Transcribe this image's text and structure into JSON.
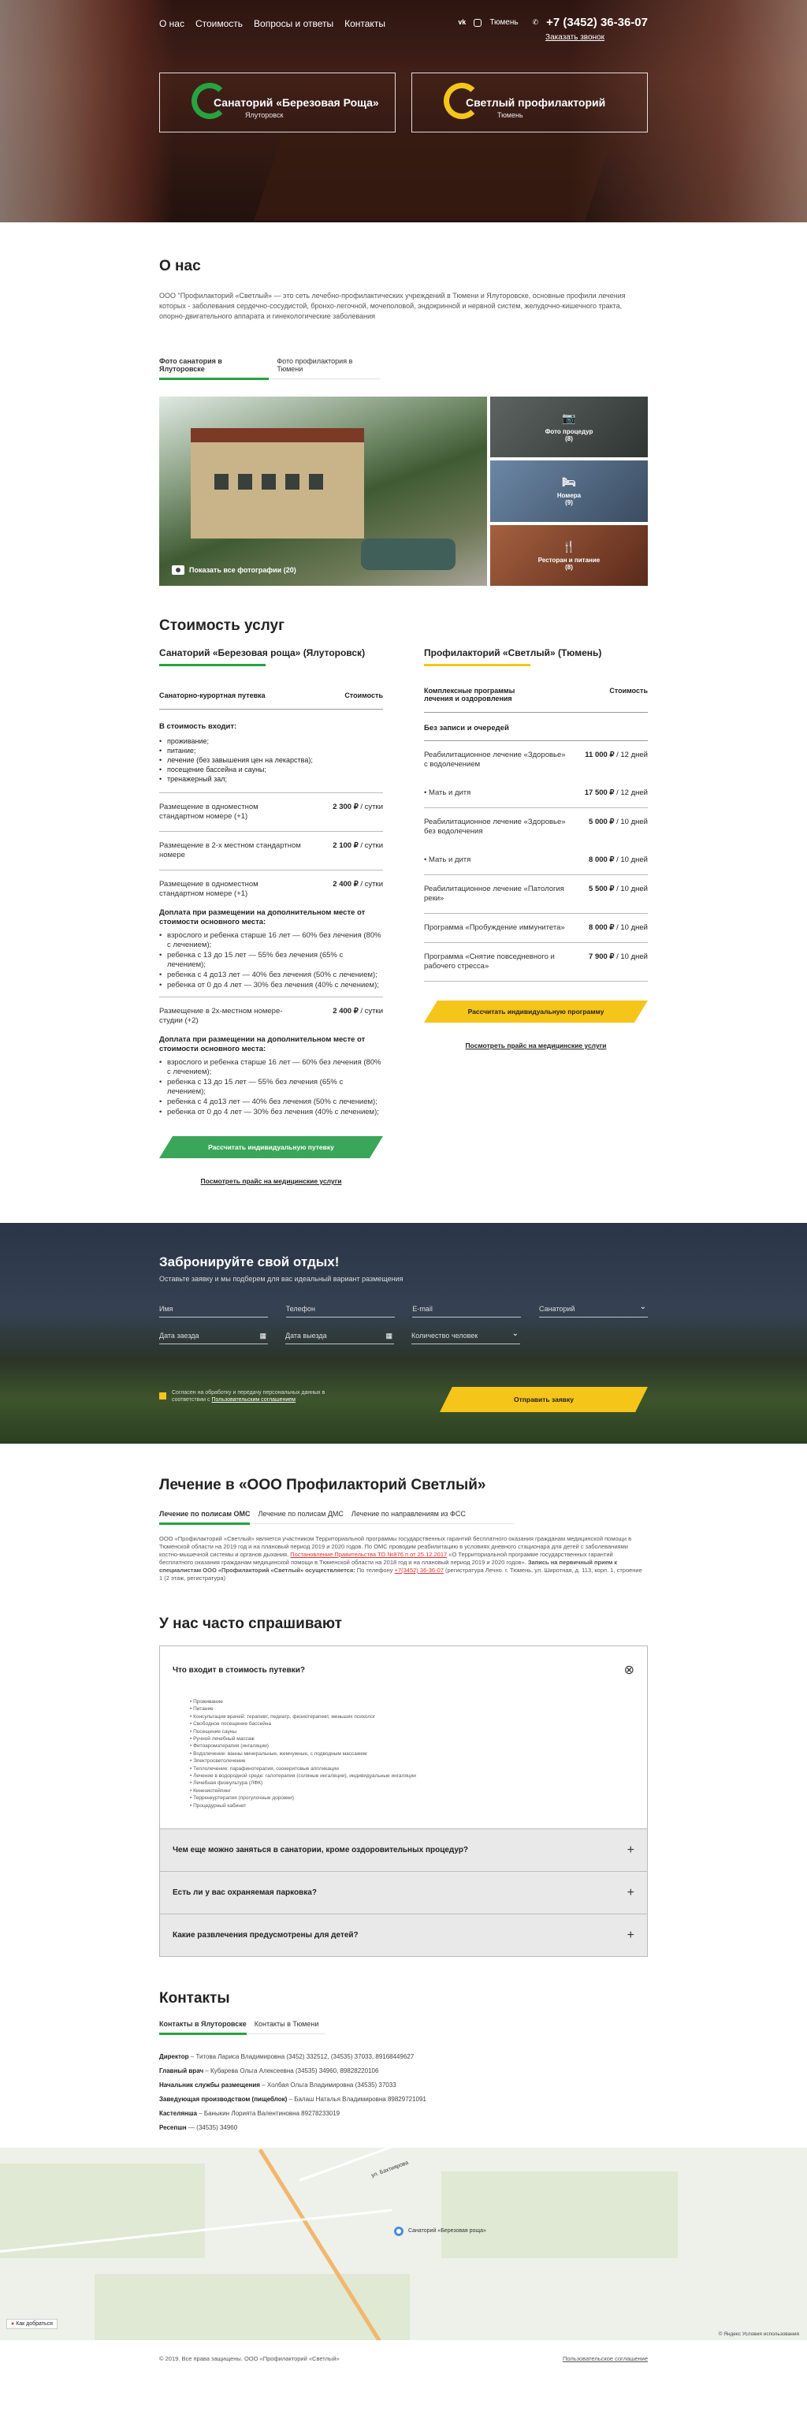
{
  "nav": {
    "items": [
      "О нас",
      "Стоимость",
      "Вопросы и ответы",
      "Контакты"
    ],
    "city": "Тюмень",
    "phone": "+7 (3452) 36-36-07",
    "callback": "Заказать звонок"
  },
  "hero": {
    "card1": {
      "title": "Санаторий «Березовая Роща»",
      "subtitle": "Ялуторовск"
    },
    "card2": {
      "title": "Светлый профилакторий",
      "subtitle": "Тюмень"
    }
  },
  "about": {
    "title": "О нас",
    "text": "ООО \"Профилакторий «Светлый» — это сеть лечебно-профилактических учреждений в Тюмени и Ялуторовске, основные профили лечения которых - заболевания сердечно-сосудистой, бронхо-легочной, мочеполовой, эндокринной и нервной систем, желудочно-кишечного тракта, опорно-двигательного аппарата и гинекологические заболевания",
    "tabs": [
      "Фото санатория в Ялуторовске",
      "Фото профилактория в Тюмени"
    ],
    "gallery": {
      "main_label": "Показать все фотографии (20)",
      "side": [
        {
          "title": "Фото процедур",
          "count": "(8)"
        },
        {
          "title": "Номера",
          "count": "(9)"
        },
        {
          "title": "Ресторан и питание",
          "count": "(8)"
        }
      ]
    }
  },
  "prices": {
    "title": "Стоимость услуг",
    "left": {
      "title": "Санаторий «Березовая роща» (Ялуторовск)",
      "head_name": "Санаторно-курортная путевка",
      "head_cost": "Стоимость",
      "includes_title": "В стоимость входит:",
      "includes": [
        "проживание;",
        "питание;",
        "лечение (без завышения цен на лекарства);",
        "посещение бассейна и сауны;",
        "тренажерный зал;"
      ],
      "rows": [
        {
          "name": "Размещение в одноместном стандартном номере (+1)",
          "price": "2 300 ₽",
          "unit": " / сутки"
        },
        {
          "name": "Размещение в 2-х местном стандартном номере",
          "price": "2 100 ₽",
          "unit": " / сутки"
        },
        {
          "name": "Размещение в одноместном стандартном номере (+1)",
          "price": "2 400 ₽",
          "unit": " / сутки"
        }
      ],
      "extra1_title": "Доплата при размещении на дополнительном месте от стоимости основного места:",
      "extra1": [
        "взрослого и ребенка старше 16 лет — 60% без лечения (80% с лечением);",
        "ребенка с 13 до 15 лет — 55% без лечения (65% с лечением);",
        "ребенка с 4 до13 лет — 40% без лечения (50% с лечением);",
        "ребенка от 0 до 4 лет — 30% без лечения (40% с лечением);"
      ],
      "row4": {
        "name": "Размещение в 2х-местном номере-студии (+2)",
        "price": "2 400 ₽",
        "unit": " / сутки"
      },
      "extra2_title": "Доплата при размещении на дополнительном месте от стоимости основного места:",
      "extra2": [
        "взрослого и ребенка старше 16 лет — 60% без лечения (80% с лечением);",
        "ребенка с 13 до 15 лет — 55% без лечения (65% с лечением);",
        "ребенка с 4 до13 лет — 40% без лечения (50% с лечением);",
        "ребенка от 0 до 4 лет — 30% без лечения (40% с лечением);"
      ],
      "button": "Рассчитать индивидуальную путевку",
      "link": "Посмотреть прайс на медицинские услуги"
    },
    "right": {
      "title": "Профилакторий «Светлый» (Тюмень)",
      "head_name": "Комплексные программы лечения и оздоровления",
      "head_cost": "Стоимость",
      "norec": "Без записи и очередей",
      "rows": [
        {
          "name": "Реабилитационное лечение «Здоровье» с водолечением",
          "price": "11 000 ₽",
          "unit": " / 12 дней"
        },
        {
          "name": "• Мать и дитя",
          "price": "17 500 ₽",
          "unit": " / 12 дней"
        },
        {
          "name": "Реабилитационное лечение «Здоровье» без водолечения",
          "price": "5 000 ₽",
          "unit": " / 10 дней"
        },
        {
          "name": "• Мать и дитя",
          "price": "8 000 ₽",
          "unit": " / 10 дней"
        },
        {
          "name": "Реабилитационное лечение «Патология реки»",
          "price": "5 500 ₽",
          "unit": " / 10 дней"
        },
        {
          "name": "Программа «Пробуждение иммунитета»",
          "price": "8 000 ₽",
          "unit": " / 10 дней"
        },
        {
          "name": "Программа «Снятие повседневного и рабочего стресса»",
          "price": "7 900 ₽",
          "unit": " / 10 дней"
        }
      ],
      "button": "Рассчитать индивидуальную программу",
      "link": "Посмотреть прайс на медицинские услуги"
    }
  },
  "booking": {
    "title": "Забронируйте свой отдых!",
    "subtitle": "Оставьте заявку и мы подберем для вас идеальный вариант размещения",
    "fields": [
      "Имя",
      "Телефон",
      "E-mail",
      "Санаторий"
    ],
    "fields2": [
      "Дата заезда",
      "Дата выезда",
      "Количество человек"
    ],
    "agree_text": "Согласен на обработку и передачу персональных данных в соответствии с ",
    "agree_link": "Пользовательским соглашением",
    "submit": "Отправить заявку"
  },
  "treatment": {
    "title": "Лечение в «ООО Профилакторий Светлый»",
    "tabs": [
      "Лечение по полисам ОМС",
      "Лечение по полисам ДМС",
      "Лечение по направлениям из ФСС"
    ],
    "text1": "ООО «Профилакторий «Светлый» является участником Территориальной программы государственных гарантий бесплатного оказания гражданам медицинской помощи в Тюменской области на 2019 год и на плановый период 2019 и 2020 годов. По ОМС проводим реабилитацию в условиях дневного стационара для детей с заболеваниями костно-мышечной системы и органов дыхания. ",
    "text_red": "Постановление Правительства ТО №876 п от 25.12.2017",
    "text2": " «О Территориальной программе государственных гарантий бесплатного оказания гражданам медицинской помощи в Тюменской области на 2018 год и на плановый период 2019 и 2020 годов». ",
    "text_bold": "Запись на первичный прием к специалистам ООО «Профилакторий «Светлый» осуществляется:",
    "text3": " По телефону ",
    "text_phone": "+7(3452) 36-36-07",
    "text4": " (регистратура Лечно. г. Тюмень, ул. Широтная, д. 113, корп. 1, строение 1 (2 этаж, регистратура)"
  },
  "faq": {
    "title": "У нас часто спрашивают",
    "open_q": "Что входит в стоимость путевки?",
    "open_a": [
      "Проживание",
      "Питание",
      "Консультация врачей: терапевт, педиатр, физиотерапевт, меньших психолог",
      "Свободное посещение бассейна",
      "Посещение сауны",
      "Ручной лечебный массаж",
      "Фитоароматерапия (ингаляции)",
      "Водолечение: ванны минеральные, жемчужные, с подводным массажем",
      "Электросветолечение",
      "Теплолечение: парафинотерапия, озокеритовые аппликации",
      "Лечение в водородной среде: галотерапия (соляные ингаляции), индивидуальные ингаляции",
      "Лечебная физкультура (ЛФК)",
      "Кинезиотейпинг",
      "Терренкуртерапия (прогулочные дорожки)",
      "Процедурный кабинет"
    ],
    "closed": [
      "Чем еще можно заняться в санатории, кроме оздоровительных процедур?",
      "Есть ли у вас охраняемая парковка?",
      "Какие развлечения предусмотрены для детей?"
    ]
  },
  "contacts": {
    "title": "Контакты",
    "tabs": [
      "Контакты в Ялуторовске",
      "Контакты в Тюмени"
    ],
    "list": [
      {
        "role": "Директор",
        "text": " – Титова Лариса Владимировна (3452) 332512, (34535) 37033, 89168449627"
      },
      {
        "role": "Главный врач",
        "text": " – Кубарева Ольга Алексеевна (34535) 34960, 89828220106"
      },
      {
        "role": "Начальник службы размещения",
        "text": " – Холбая Ольга Владимировна (34535) 37033"
      },
      {
        "role": "Заведующая производством (пищеблок)",
        "text": " – Балаш Наталья Владимировна 89829721091"
      },
      {
        "role": "Кастелянша",
        "text": " – Баныкин Лорията Валентиновна 89278233019"
      },
      {
        "role": "Ресепшн",
        "text": " — (34535) 34960"
      }
    ]
  },
  "map": {
    "street": "ул. Бахтиярова",
    "label": "Санаторий «Березовая роща»",
    "tag": "Как добраться",
    "copy": "© Яндекс  Условия использования"
  },
  "footer": {
    "copy": "© 2019. Все права защищены. ООО «Профилакторий «Светлый»",
    "link": "Пользовательское соглашение"
  },
  "colors": {
    "green": "#27a340",
    "yellow": "#f5c51a"
  }
}
